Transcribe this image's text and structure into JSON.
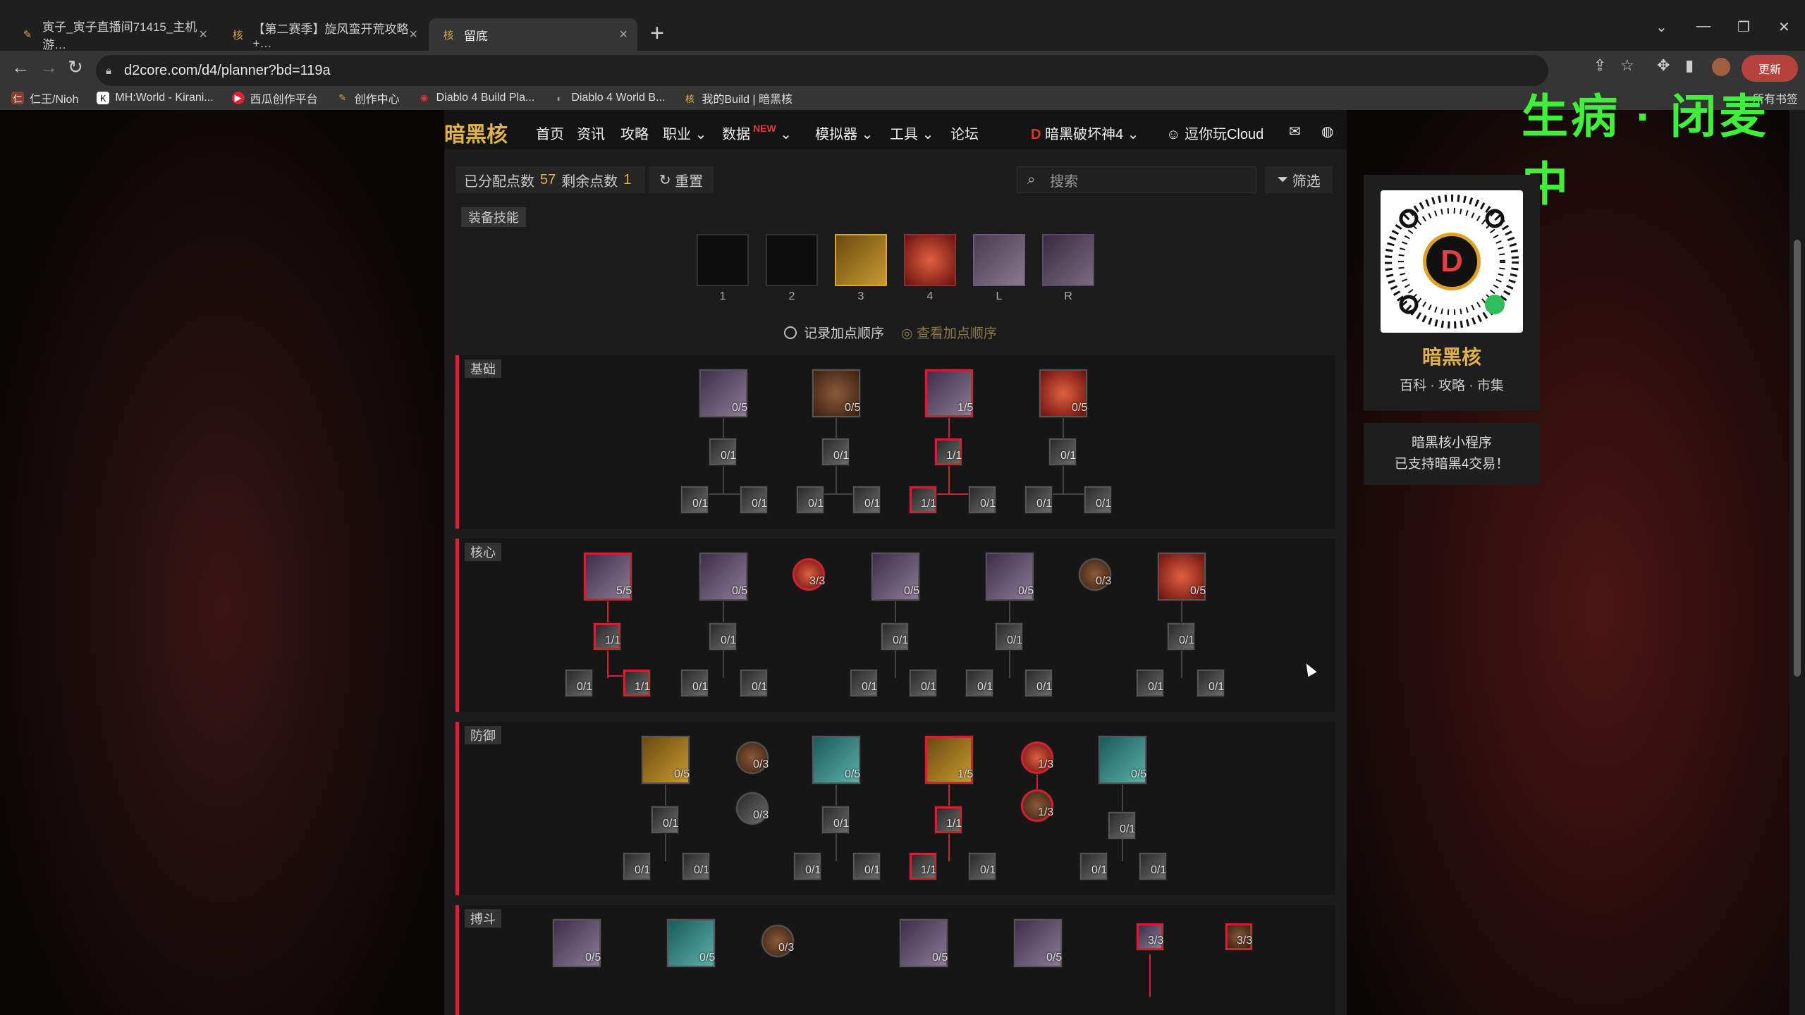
{
  "browser": {
    "tabs": [
      {
        "title": "寅子_寅子直播间71415_主机游…",
        "icon": "bilibili-icon"
      },
      {
        "title": "【第二赛季】旋风蛮开荒攻略+…",
        "icon": "d2core-icon"
      },
      {
        "title": "留底",
        "icon": "d2core-icon"
      }
    ],
    "url": "d2core.com/d4/planner?bd=119a",
    "update_label": "更新",
    "bookmarks": [
      {
        "label": "仁王/Nioh"
      },
      {
        "label": "MH:World - Kirani..."
      },
      {
        "label": "西瓜创作平台"
      },
      {
        "label": "创作中心"
      },
      {
        "label": "Diablo 4 Build Pla..."
      },
      {
        "label": "Diablo 4 World B..."
      },
      {
        "label": "我的Build | 暗黑核"
      },
      {
        "label": "所有书签"
      }
    ]
  },
  "overlay": {
    "text": "生病 · 闭麦中"
  },
  "site": {
    "logo": "暗黑核",
    "menu": [
      "首页",
      "资讯",
      "攻略",
      "职业",
      "数据",
      "模拟器",
      "工具",
      "论坛"
    ],
    "new_badge": "NEW",
    "game_selector": "暗黑破坏神4",
    "username": "逗你玩Cloud"
  },
  "planner": {
    "allocated_label": "已分配点数",
    "allocated_value": "57",
    "remaining_label": "剩余点数",
    "remaining_value": "1",
    "reset_label": "重置",
    "search_placeholder": "搜索",
    "filter_label": "筛选",
    "equipped_label": "装备技能",
    "slots": [
      "1",
      "2",
      "3",
      "4",
      "L",
      "R"
    ],
    "record_label": "记录加点顺序",
    "view_order_label": "查看加点顺序",
    "sections": [
      {
        "name": "基础",
        "big": [
          "0/5",
          "0/5",
          "1/5",
          "0/5"
        ],
        "mid": [
          "0/1",
          "0/1",
          "1/1",
          "0/1"
        ],
        "leaf": [
          "0/1",
          "0/1",
          "0/1",
          "0/1",
          "1/1",
          "0/1",
          "0/1",
          "0/1"
        ]
      },
      {
        "name": "核心",
        "big": [
          "5/5",
          "0/5",
          "3/3",
          "0/5",
          "0/5",
          "0/3",
          "0/5"
        ],
        "mid": [
          "1/1",
          "0/1",
          "0/1",
          "0/1",
          "0/1"
        ],
        "leaf": [
          "0/1",
          "1/1",
          "0/1",
          "0/1",
          "0/1",
          "0/1",
          "0/1",
          "0/1",
          "0/1",
          "0/1"
        ]
      },
      {
        "name": "防御",
        "big": [
          "0/5",
          "0/3",
          "0/3",
          "0/5",
          "1/5",
          "1/3",
          "1/3",
          "0/5"
        ],
        "mid": [
          "0/1",
          "0/1",
          "1/1",
          "0/1"
        ],
        "leaf": [
          "0/1",
          "0/1",
          "0/1",
          "0/1",
          "1/1",
          "0/1",
          "0/1",
          "0/1"
        ]
      },
      {
        "name": "搏斗",
        "big": [
          "0/5",
          "0/5",
          "0/3",
          "0/5",
          "0/5",
          "3/3",
          "3/3"
        ]
      }
    ]
  },
  "sidebar": {
    "brand": "暗黑核",
    "brand_sub": "百科 · 攻略 · 市集",
    "promo_line1": "暗黑核小程序",
    "promo_line2": "已支持暗黑4交易！"
  }
}
